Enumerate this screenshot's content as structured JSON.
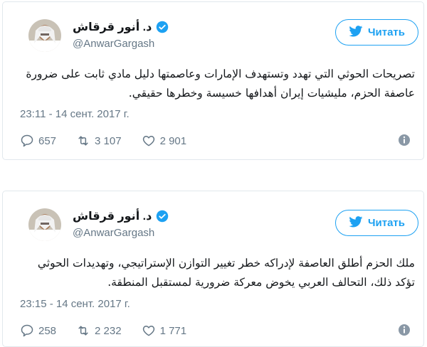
{
  "colors": {
    "accent": "#1da1f2",
    "muted": "#657786",
    "text": "#14171a",
    "border": "#e1e8ed"
  },
  "tweets": [
    {
      "author_name": "د. أنور قرقاش",
      "handle": "@AnwarGargash",
      "follow_label": "Читать",
      "text_line1": "تصريحات الحوثي التي تهدد وتستهدف الإمارات وعاصمتها دليل مادي ثابت على ضرورة",
      "text_line2": "عاصفة الحزم، مليشيات إيران أهدافها خسيسة وخطرها حقيقي.",
      "timestamp": "23:11 - 14 сент. 2017 г.",
      "replies": "657",
      "retweets": "3 107",
      "likes": "2 901",
      "icons": [
        "twitter-bird-icon",
        "verified-badge-icon",
        "reply-icon",
        "retweet-icon",
        "like-icon",
        "info-icon"
      ]
    },
    {
      "author_name": "د. أنور قرقاش",
      "handle": "@AnwarGargash",
      "follow_label": "Читать",
      "text_line1": "ملك الحزم أطلق العاصفة لإدراكه خطر تغيير التوازن الإستراتيجي، وتهديدات الحوثي",
      "text_line2": "تؤكد ذلك، التحالف العربي يخوض معركة ضرورية لمستقبل المنطقة.",
      "timestamp": "23:15 - 14 сент. 2017 г.",
      "replies": "258",
      "retweets": "2 232",
      "likes": "1 771",
      "icons": [
        "twitter-bird-icon",
        "verified-badge-icon",
        "reply-icon",
        "retweet-icon",
        "like-icon",
        "info-icon"
      ]
    }
  ]
}
